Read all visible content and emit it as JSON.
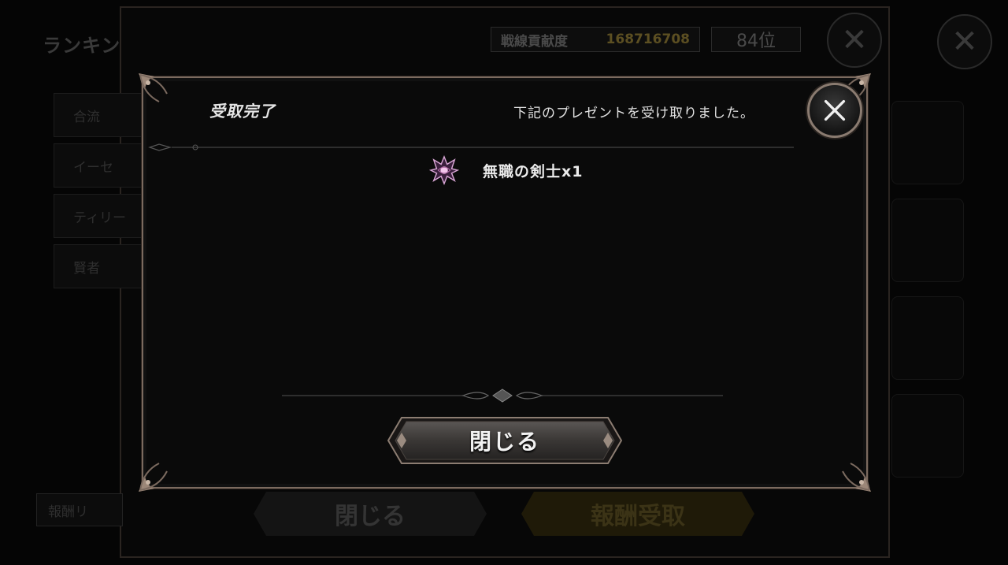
{
  "background": {
    "screen_title": "ランキン",
    "subtitle": "",
    "score_label": "戦線貢献度",
    "score_value": "168716708",
    "rank_value": "84位",
    "tabs": [
      "合流",
      "イーセ",
      "ティリー",
      "賢者"
    ],
    "reward_button_label": "報酬リ",
    "close_button_label": "閉じる",
    "claim_button_label": "報酬受取",
    "colors": {
      "claim_gold": "#3b3316"
    }
  },
  "modal": {
    "title": "受取完了",
    "message": "下記のプレゼントを受け取りました。",
    "reward": {
      "icon": "job-crest-icon",
      "text": "無職の剣士x1"
    },
    "close_button_label": "閉じる"
  },
  "colors": {
    "frame_border": "#7b6a5f",
    "panel_bg": "#0a0a0a"
  }
}
